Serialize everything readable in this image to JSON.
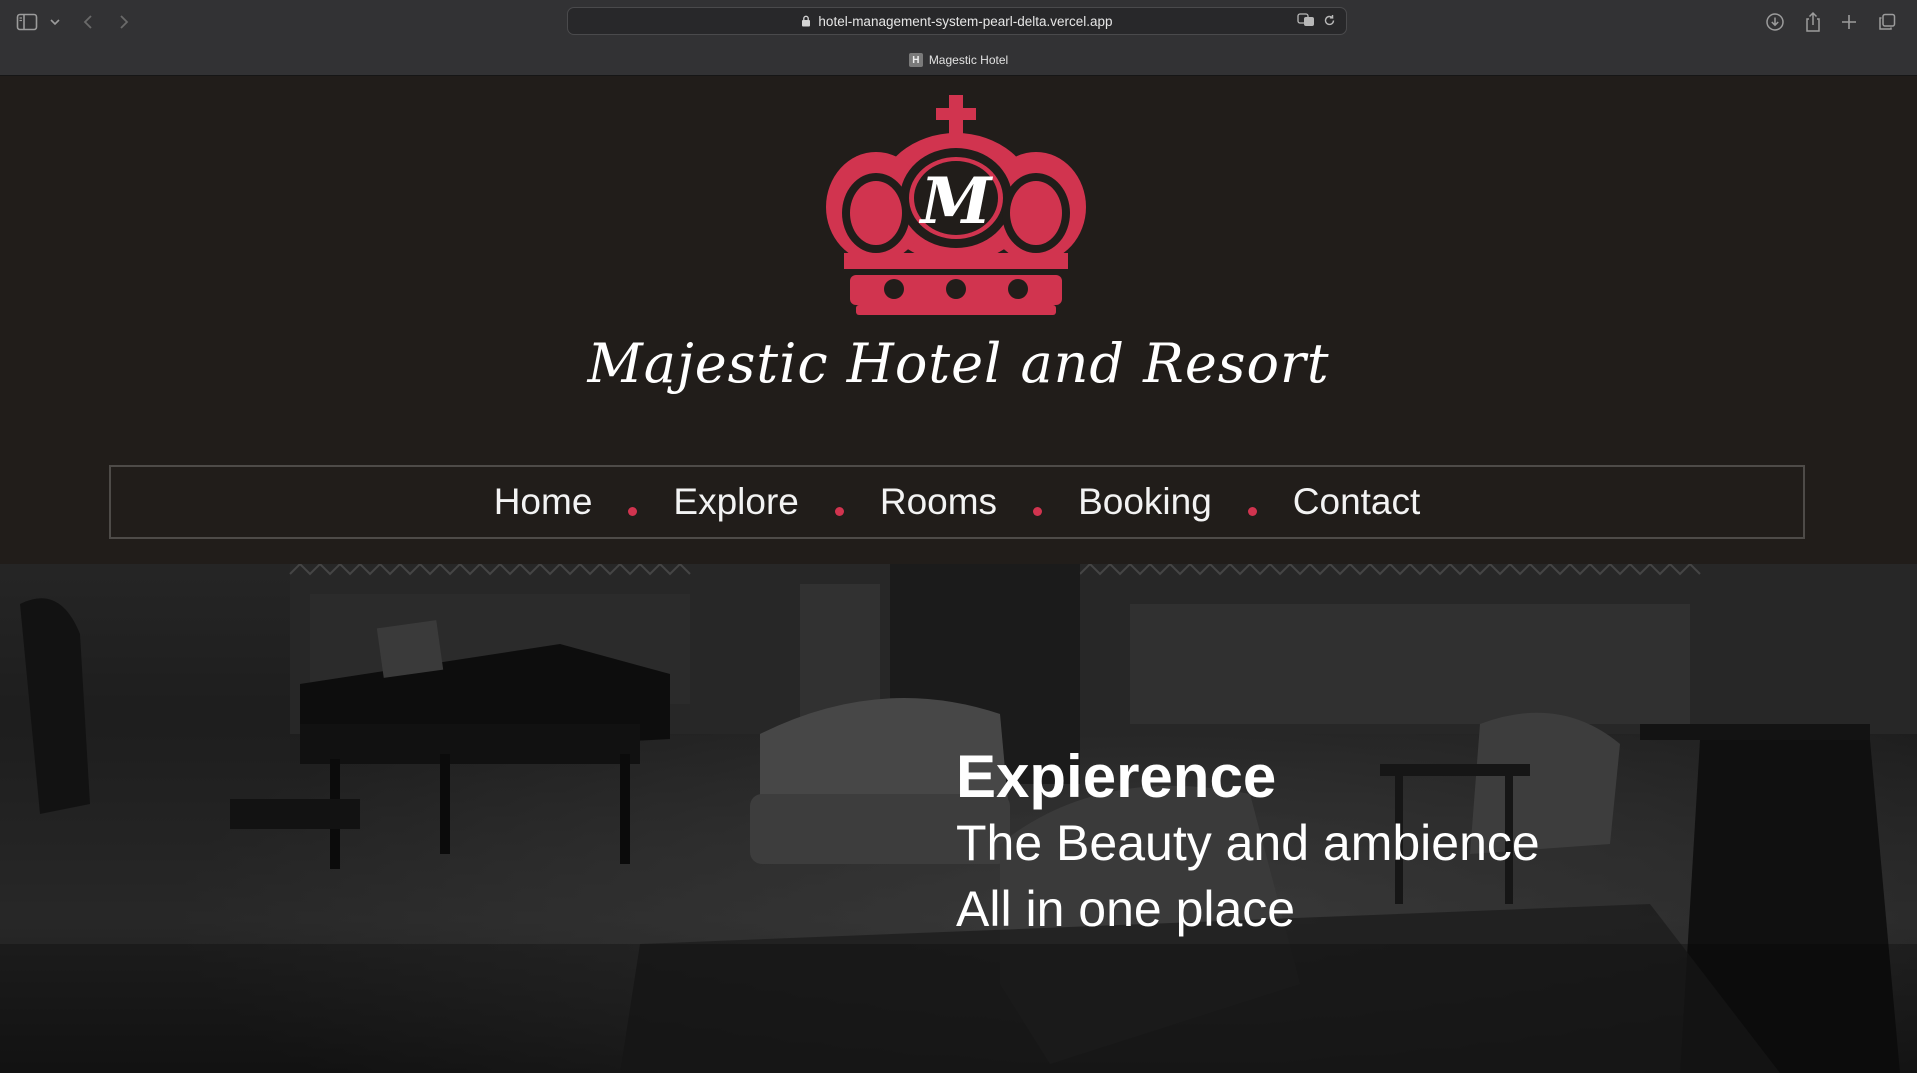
{
  "browser": {
    "url": "hotel-management-system-pearl-delta.vercel.app",
    "tab_title": "Magestic Hotel",
    "tab_favicon": "H",
    "icons": [
      "sidebar-icon",
      "chevron-down-icon",
      "back-icon",
      "forward-icon",
      "lock-icon",
      "translate-icon",
      "reload-icon",
      "download-icon",
      "share-icon",
      "new-tab-icon",
      "tabs-overview-icon"
    ]
  },
  "header": {
    "logo_letter": "M",
    "brand_name": "Majestic Hotel and Resort",
    "accent_color": "#d1344f"
  },
  "nav": {
    "items": [
      {
        "label": "Home"
      },
      {
        "label": "Explore"
      },
      {
        "label": "Rooms"
      },
      {
        "label": "Booking"
      },
      {
        "label": "Contact"
      }
    ]
  },
  "hero": {
    "title": "Expierence",
    "line1": "The Beauty and ambience",
    "line2": "All in one place"
  }
}
